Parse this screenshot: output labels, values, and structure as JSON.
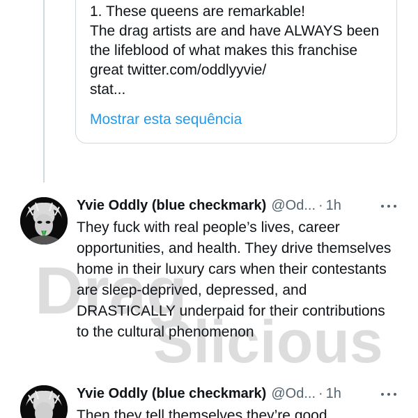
{
  "quoted_tweet": {
    "text": "1. These queens are remarkable!\nThe drag artists are and have ALWAYS been the lifeblood of what makes this franchise great twitter.com/oddlyyvie/\nstat...",
    "show_thread_label": "Mostrar esta sequência"
  },
  "tweets": [
    {
      "author_name": "Yvie Oddly (blue checkmark)",
      "handle": "@Od...",
      "separator": "·",
      "time": "1h",
      "body": "They fuck with real people’s lives, career opportunities, and health. They drive themselves home in their luxury cars when their contestants are sleep-deprived, depressed, and DRASTICALLY underpaid for their contributions to the cultural phenomenon"
    },
    {
      "author_name": "Yvie Oddly (blue checkmark)",
      "handle": "@Od...",
      "separator": "·",
      "time": "1h",
      "body": "Then they tell themselves they’re good"
    }
  ],
  "watermark": {
    "line1": "Drag",
    "line2": "Slicious"
  },
  "colors": {
    "link": "#1d9bf0",
    "secondary_text": "#536471",
    "border": "#cfd9de",
    "primary_text": "#0f1419"
  },
  "icons": {
    "more": "more-horizontal-icon"
  }
}
